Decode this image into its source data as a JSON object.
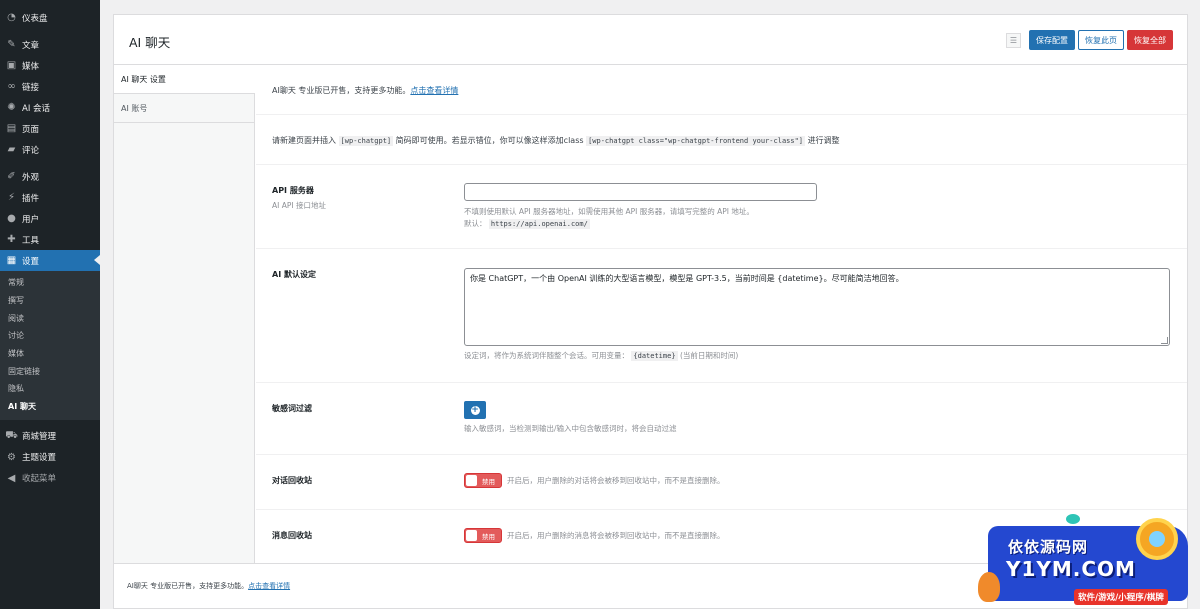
{
  "sidebar": {
    "top_items": [
      {
        "label": "仪表盘",
        "icon": "dashboard-icon"
      },
      {
        "label": "文章",
        "icon": "pin-icon"
      },
      {
        "label": "媒体",
        "icon": "media-icon"
      },
      {
        "label": "链接",
        "icon": "link-icon"
      },
      {
        "label": "AI 会话",
        "icon": "openai-icon"
      },
      {
        "label": "页面",
        "icon": "page-icon"
      },
      {
        "label": "评论",
        "icon": "comment-icon"
      },
      {
        "label": "外观",
        "icon": "brush-icon"
      },
      {
        "label": "插件",
        "icon": "plugin-icon"
      },
      {
        "label": "用户",
        "icon": "user-icon"
      },
      {
        "label": "工具",
        "icon": "wrench-icon"
      },
      {
        "label": "设置",
        "icon": "settings-icon"
      }
    ],
    "submenu": [
      "常规",
      "撰写",
      "阅读",
      "讨论",
      "媒体",
      "固定链接",
      "隐私",
      "AI 聊天"
    ],
    "bottom_items": [
      {
        "label": "商城管理",
        "icon": "cart-icon"
      },
      {
        "label": "主题设置",
        "icon": "gear-icon"
      },
      {
        "label": "收起菜单",
        "icon": "collapse-icon"
      }
    ]
  },
  "header": {
    "title": "AI 聊天",
    "save_label": "保存配置",
    "restore_page_label": "恢复此页",
    "restore_all_label": "恢复全部"
  },
  "tabs": [
    "AI 聊天 设置",
    "AI 账号"
  ],
  "notice": {
    "text": "AI聊天 专业版已开售，支持更多功能。",
    "link": "点击查看详情"
  },
  "shortcode": {
    "before": "请新建页面并插入",
    "code1": "[wp-chatgpt]",
    "middle": "简码即可使用。若显示错位，你可以像这样添加class",
    "code2": "[wp-chatgpt class=\"wp-chatgpt-frontend your-class\"]",
    "after": "进行调整"
  },
  "api_server": {
    "label": "API 服务器",
    "sublabel": "AI API 接口地址",
    "value": "",
    "desc": "不填则使用默认 API 服务器地址，如需使用其他 API 服务器，请填写完整的 API 地址。",
    "default_prefix": "默认：",
    "default_value": "https://api.openai.com/"
  },
  "ai_default": {
    "label": "AI 默认设定",
    "value": "你是 ChatGPT，一个由 OpenAI 训练的大型语言模型，模型是 GPT-3.5，当前时间是 {datetime}。尽可能简洁地回答。",
    "desc_before": "设定词，将作为系统词伴随整个会话。可用变量：",
    "desc_code": "{datetime}",
    "desc_after": "(当前日期和时间)"
  },
  "sensitive": {
    "label": "敏感词过滤",
    "add_symbol": "+",
    "desc": "输入敏感词，当检测到输出/输入中包含敏感词时，将会自动过滤"
  },
  "chat_recycle": {
    "label": "对话回收站",
    "toggle_label": "禁用",
    "desc": "开启后，用户删除的对话将会被移到回收站中，而不是直接删除。"
  },
  "msg_recycle": {
    "label": "消息回收站",
    "toggle_label": "禁用",
    "desc": "开启后，用户删除的消息将会被移到回收站中，而不是直接删除。"
  },
  "footer": {
    "text": "AI聊天 专业版已开售，支持更多功能。",
    "link": "点击查看详情"
  },
  "watermark": {
    "line1": "依依源码网",
    "line2": "Y1YM.COM",
    "line3": "软件/游戏/小程序/棋牌"
  },
  "colors": {
    "sidebar_bg": "#1d2327",
    "accent": "#2271b1",
    "danger": "#d63638"
  }
}
